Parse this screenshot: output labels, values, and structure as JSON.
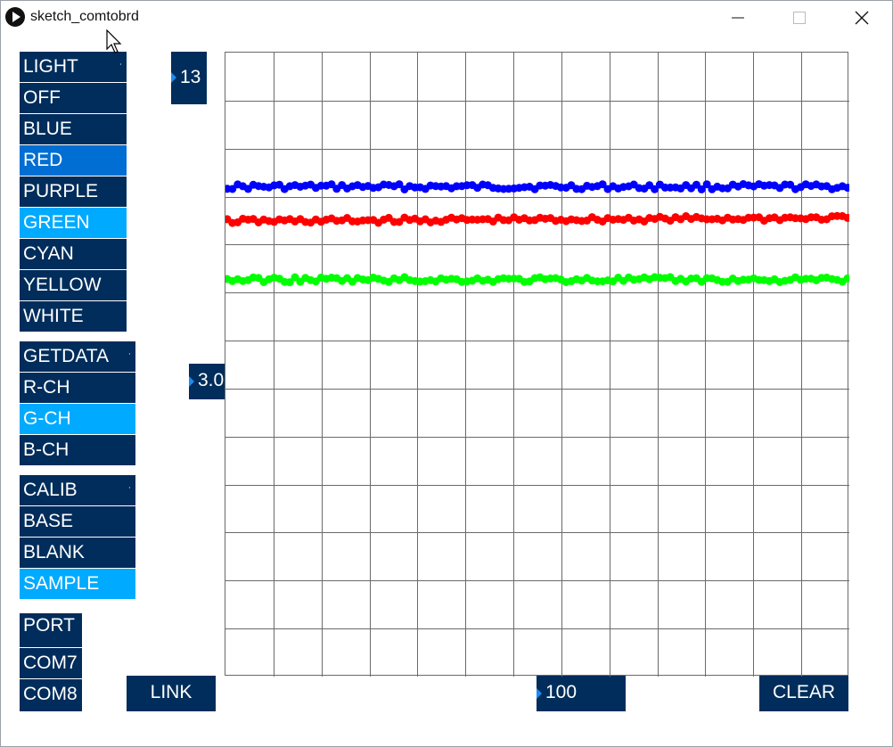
{
  "window": {
    "title": "sketch_comtobrd"
  },
  "light_menu": {
    "header": "LIGHT",
    "items": [
      "OFF",
      "BLUE",
      "RED",
      "PURPLE",
      "GREEN",
      "CYAN",
      "YELLOW",
      "WHITE"
    ],
    "selected": "RED",
    "active": "GREEN"
  },
  "getdata_menu": {
    "header": "GETDATA",
    "items": [
      "R-CH",
      "G-CH",
      "B-CH"
    ],
    "active": "G-CH"
  },
  "calib_menu": {
    "header": "CALIB",
    "items": [
      "BASE",
      "BLANK",
      "SAMPLE"
    ],
    "active": "SAMPLE"
  },
  "port_menu": {
    "header": "PORT",
    "items": [
      "COM7",
      "COM8"
    ]
  },
  "controls": {
    "top_value": "13",
    "mid_value": "3.0",
    "bottom_value": "100",
    "link_label": "LINK",
    "clear_label": "CLEAR"
  },
  "colors": {
    "button_bg": "#002d5b",
    "selected_bg": "#006ed2",
    "active_bg": "#00aaff",
    "series_blue": "#0000ff",
    "series_red": "#ff0000",
    "series_green": "#00ff00"
  },
  "chart_data": {
    "type": "scatter",
    "grid": true,
    "grid_cols": 13,
    "grid_rows": 13,
    "points_per_series": 120,
    "series": [
      {
        "color": "#0000ff",
        "level": 0.215
      },
      {
        "color": "#ff0000",
        "level": 0.265
      },
      {
        "color": "#00ff00",
        "level": 0.364
      }
    ]
  }
}
